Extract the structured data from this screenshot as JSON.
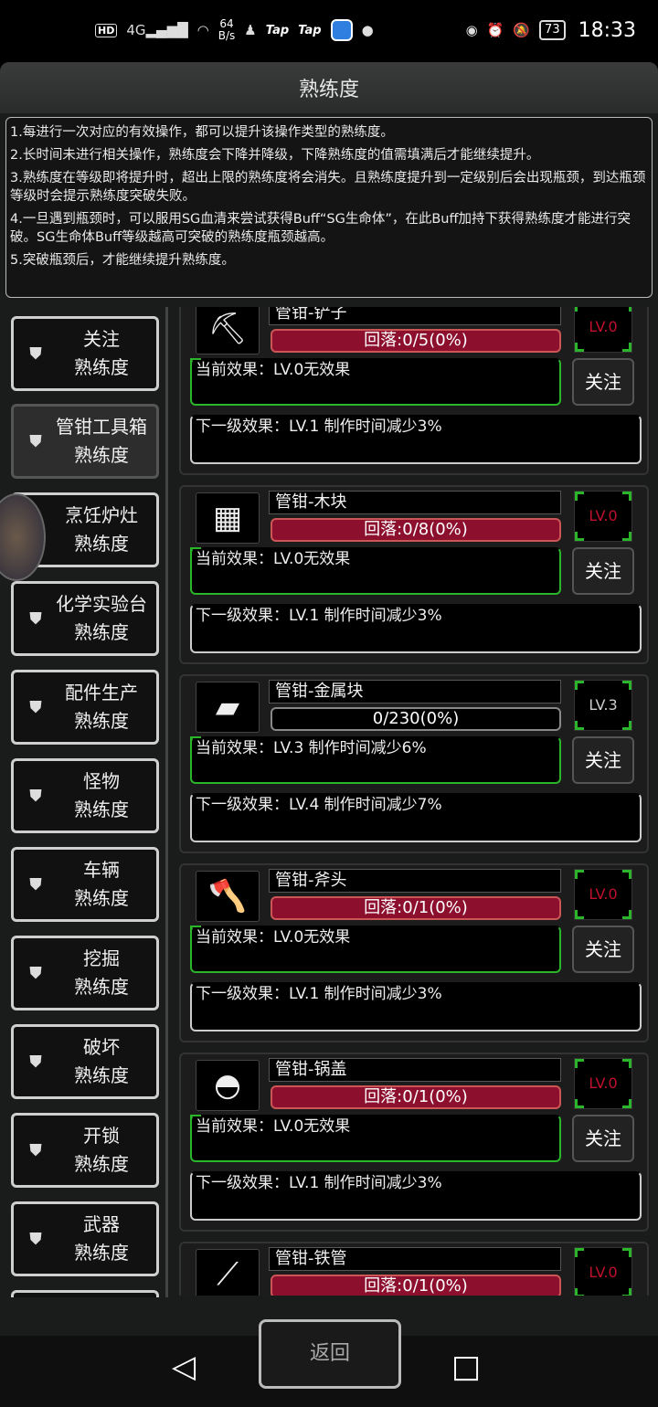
{
  "status_bar": {
    "hd": "HD",
    "network": "4G",
    "speed_value": "64",
    "speed_unit": "B/s",
    "tap1": "Tap",
    "tap2": "Tap",
    "battery": "73",
    "time": "18:33"
  },
  "title": "熟练度",
  "info_lines": [
    "1.每进行一次对应的有效操作，都可以提升该操作类型的熟练度。",
    "2.长时间未进行相关操作，熟练度会下降并降级，下降熟练度的值需填满后才能继续提升。",
    "3.熟练度在等级即将提升时，超出上限的熟练度将会消失。且熟练度提升到一定级别后会出现瓶颈，到达瓶颈等级时会提示熟练度突破失败。",
    "4.一旦遇到瓶颈时，可以服用SG血清来尝试获得Buff“SG生命体”，在此Buff加持下获得熟练度才能进行突破。SG生命体Buff等级越高可突破的熟练度瓶颈越高。",
    "5.突破瓶颈后，才能继续提升熟练度。"
  ],
  "sidebar": [
    {
      "line1": "关注",
      "line2": "熟练度"
    },
    {
      "line1": "管钳工具箱",
      "line2": "熟练度"
    },
    {
      "line1": "烹饪炉灶",
      "line2": "熟练度"
    },
    {
      "line1": "化学实验台",
      "line2": "熟练度"
    },
    {
      "line1": "配件生产",
      "line2": "熟练度"
    },
    {
      "line1": "怪物",
      "line2": "熟练度"
    },
    {
      "line1": "车辆",
      "line2": "熟练度"
    },
    {
      "line1": "挖掘",
      "line2": "熟练度"
    },
    {
      "line1": "破坏",
      "line2": "熟练度"
    },
    {
      "line1": "开锁",
      "line2": "熟练度"
    },
    {
      "line1": "武器",
      "line2": "熟练度"
    }
  ],
  "items": [
    {
      "name": "管钳-铲子",
      "progress": "回落:0/5(0%)",
      "level": "LV.0",
      "current": "当前效果：LV.0无效果",
      "next": "下一级效果：LV.1 制作时间减少3%",
      "follow": "关注"
    },
    {
      "name": "管钳-木块",
      "progress": "回落:0/8(0%)",
      "level": "LV.0",
      "current": "当前效果：LV.0无效果",
      "next": "下一级效果：LV.1 制作时间减少3%",
      "follow": "关注"
    },
    {
      "name": "管钳-金属块",
      "progress": "0/230(0%)",
      "level": "LV.3",
      "current": "当前效果：LV.3 制作时间减少6%",
      "next": "下一级效果：LV.4 制作时间减少7%",
      "follow": "关注"
    },
    {
      "name": "管钳-斧头",
      "progress": "回落:0/1(0%)",
      "level": "LV.0",
      "current": "当前效果：LV.0无效果",
      "next": "下一级效果：LV.1 制作时间减少3%",
      "follow": "关注"
    },
    {
      "name": "管钳-锅盖",
      "progress": "回落:0/1(0%)",
      "level": "LV.0",
      "current": "当前效果：LV.0无效果",
      "next": "下一级效果：LV.1 制作时间减少3%",
      "follow": "关注"
    },
    {
      "name": "管钳-铁管",
      "progress": "回落:0/1(0%)",
      "level": "LV.0",
      "current": "",
      "next": "",
      "follow": ""
    }
  ],
  "back_label": "返回"
}
